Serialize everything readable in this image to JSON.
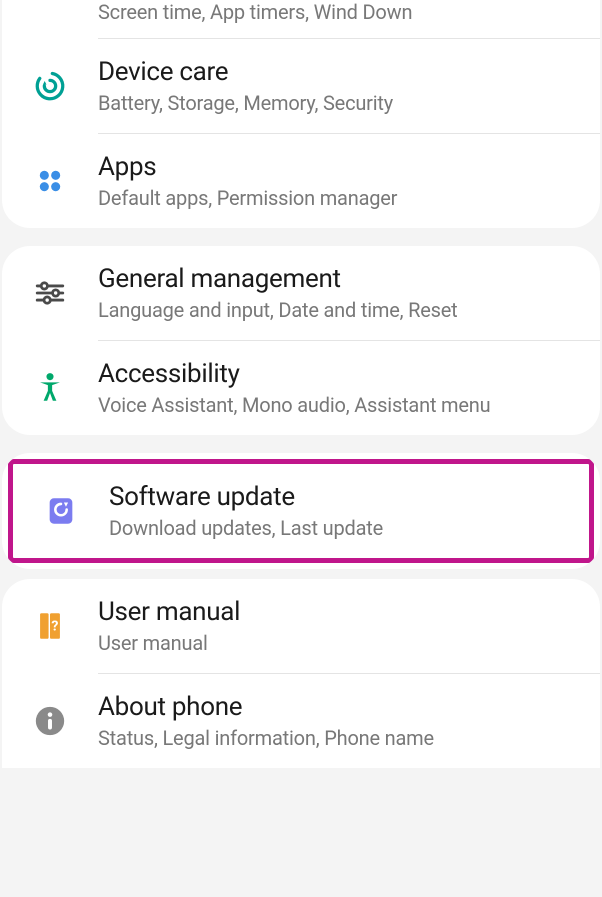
{
  "group1": {
    "digital_wellbeing": {
      "subtitle": "Screen time, App timers, Wind Down"
    },
    "device_care": {
      "title": "Device care",
      "subtitle": "Battery, Storage, Memory, Security"
    },
    "apps": {
      "title": "Apps",
      "subtitle": "Default apps, Permission manager"
    }
  },
  "group2": {
    "general_management": {
      "title": "General management",
      "subtitle": "Language and input, Date and time, Reset"
    },
    "accessibility": {
      "title": "Accessibility",
      "subtitle": "Voice Assistant, Mono audio, Assistant menu"
    }
  },
  "group3": {
    "software_update": {
      "title": "Software update",
      "subtitle": "Download updates, Last update"
    }
  },
  "group4": {
    "user_manual": {
      "title": "User manual",
      "subtitle": "User manual"
    },
    "about_phone": {
      "title": "About phone",
      "subtitle": "Status, Legal information, Phone name"
    }
  },
  "colors": {
    "highlight": "#c0168b",
    "device_care_icon": "#00a094",
    "apps_icon": "#3a8ee6",
    "general_icon": "#4a4a4a",
    "accessibility_icon": "#00a86b",
    "software_icon": "#7b7cf0",
    "manual_icon": "#f0a030",
    "about_icon": "#8a8a8a"
  }
}
